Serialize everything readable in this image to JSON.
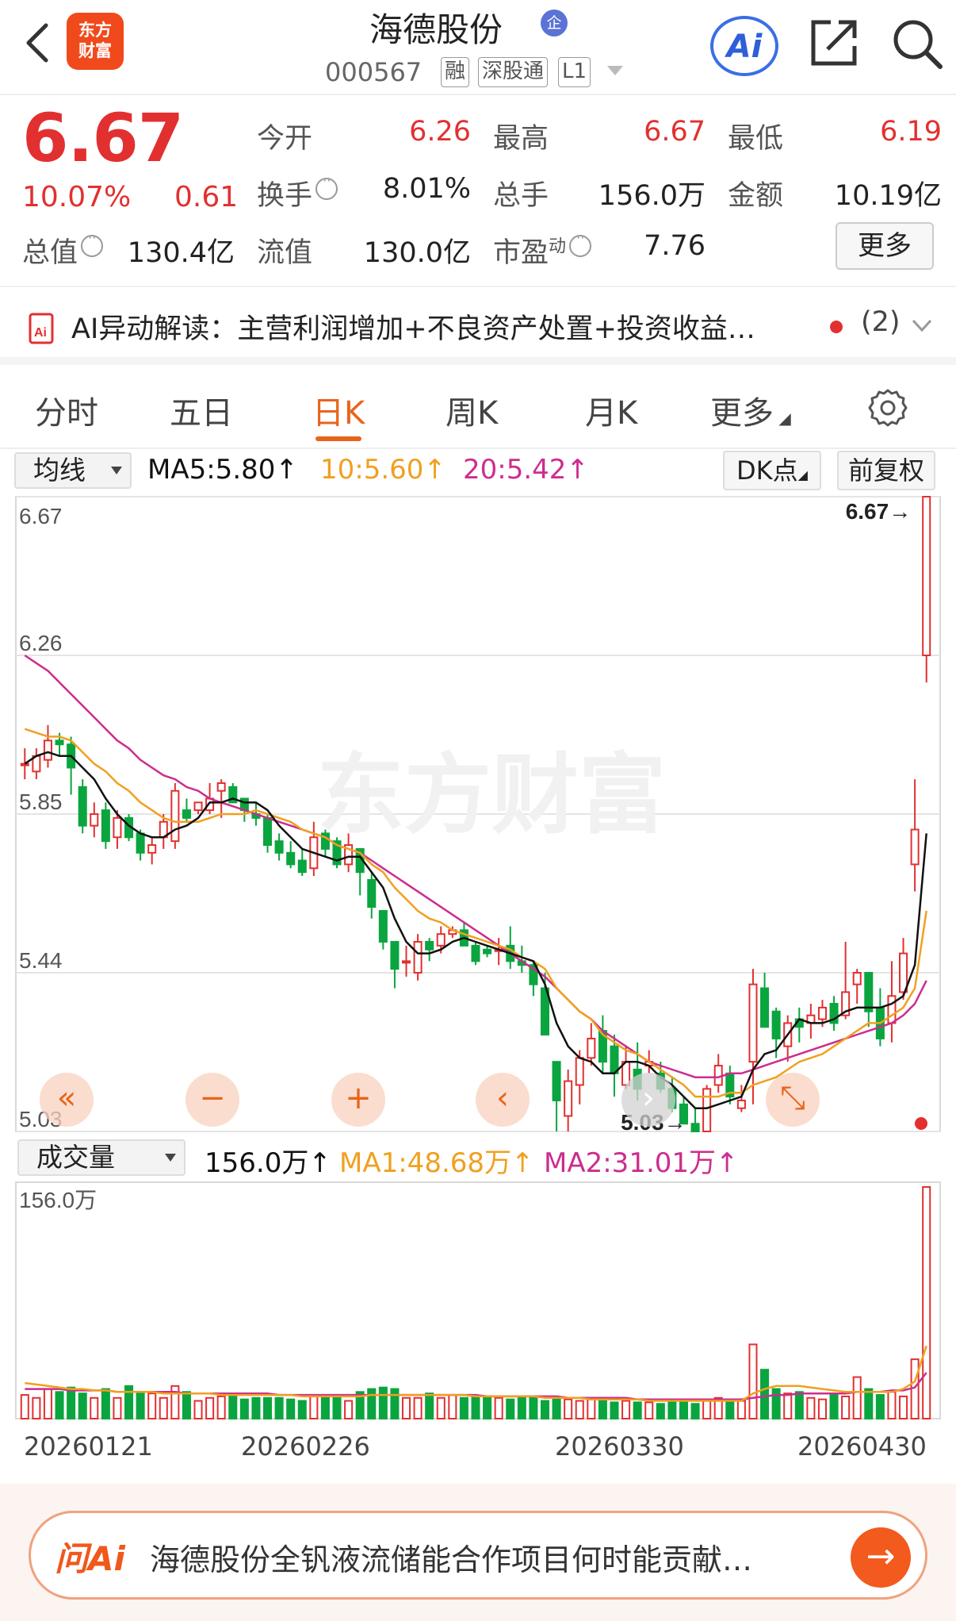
{
  "header": {
    "stock_name": "海德股份",
    "badge": "企",
    "code": "000567",
    "tags": [
      "融",
      "深股通",
      "L1"
    ],
    "logo_line1": "东方",
    "logo_line2": "财富",
    "ai_label": "Ai"
  },
  "quote": {
    "price": "6.67",
    "change_pct": "10.07%",
    "change_amt": "0.61",
    "fields": {
      "open_label": "今开",
      "open": "6.26",
      "high_label": "最高",
      "high": "6.67",
      "low_label": "最低",
      "low": "6.19",
      "turnover_label": "换手",
      "turnover": "8.01%",
      "volume_label": "总手",
      "volume": "156.0万",
      "amount_label": "金额",
      "amount": "10.19亿",
      "mktcap_label": "总值",
      "mktcap": "130.4亿",
      "float_label": "流值",
      "float": "130.0亿",
      "pe_label": "市盈",
      "pe_sup": "动",
      "pe": "7.76"
    },
    "more_label": "更多"
  },
  "ai_strip": {
    "text": "AI异动解读：主营利润增加+不良资产处置+投资收益…",
    "count": "(2)"
  },
  "tabs": [
    "分时",
    "五日",
    "日K",
    "周K",
    "月K",
    "更多"
  ],
  "active_tab": 2,
  "ma_bar": {
    "indicator": "均线",
    "ma5": "MA5:5.80",
    "ma10": "10:5.60",
    "ma20": "20:5.42",
    "dk_label": "DK点",
    "fuquan_label": "前复权"
  },
  "volume_bar": {
    "indicator": "成交量",
    "vol": "156.0万",
    "ma1": "MA1:48.68万",
    "ma2": "MA2:31.01万",
    "axis_top": "156.0万"
  },
  "controls": [
    "«",
    "−",
    "+",
    "‹",
    "›",
    "⤡"
  ],
  "chart_data": {
    "type": "candlestick",
    "y_ticks": [
      "6.67",
      "6.26",
      "5.85",
      "5.44",
      "5.03"
    ],
    "ylim": [
      5.03,
      6.67
    ],
    "max_label": "6.67",
    "min_label": "5.03",
    "x_labels": [
      "20260121",
      "20260226",
      "20260330",
      "20260430"
    ],
    "watermark": "东方财富",
    "colors": {
      "up": "#e23030",
      "down": "#0aa53f",
      "ma5": "#111111",
      "ma10": "#f0a020",
      "ma20": "#cc2d8e"
    },
    "candles": [
      [
        5.98,
        5.98,
        5.94,
        6.02
      ],
      [
        5.96,
        6.0,
        5.94,
        6.02
      ],
      [
        5.99,
        6.04,
        5.97,
        6.08
      ],
      [
        6.04,
        6.03,
        6.0,
        6.06
      ],
      [
        6.03,
        5.97,
        5.9,
        6.05
      ],
      [
        5.92,
        5.82,
        5.8,
        5.94
      ],
      [
        5.82,
        5.85,
        5.79,
        5.88
      ],
      [
        5.86,
        5.78,
        5.76,
        5.88
      ],
      [
        5.79,
        5.84,
        5.76,
        5.86
      ],
      [
        5.84,
        5.79,
        5.78,
        5.85
      ],
      [
        5.8,
        5.75,
        5.73,
        5.81
      ],
      [
        5.75,
        5.77,
        5.72,
        5.79
      ],
      [
        5.79,
        5.83,
        5.76,
        5.85
      ],
      [
        5.78,
        5.91,
        5.76,
        5.93
      ],
      [
        5.86,
        5.84,
        5.83,
        5.89
      ],
      [
        5.86,
        5.88,
        5.85,
        5.88
      ],
      [
        5.86,
        5.89,
        5.85,
        5.93
      ],
      [
        5.91,
        5.93,
        5.84,
        5.94
      ],
      [
        5.92,
        5.88,
        5.88,
        5.93
      ],
      [
        5.89,
        5.86,
        5.83,
        5.89
      ],
      [
        5.85,
        5.84,
        5.82,
        5.88
      ],
      [
        5.84,
        5.77,
        5.75,
        5.85
      ],
      [
        5.78,
        5.75,
        5.73,
        5.8
      ],
      [
        5.75,
        5.72,
        5.71,
        5.78
      ],
      [
        5.73,
        5.7,
        5.69,
        5.76
      ],
      [
        5.71,
        5.79,
        5.69,
        5.83
      ],
      [
        5.8,
        5.76,
        5.74,
        5.81
      ],
      [
        5.78,
        5.72,
        5.71,
        5.79
      ],
      [
        5.72,
        5.77,
        5.7,
        5.8
      ],
      [
        5.76,
        5.7,
        5.64,
        5.76
      ],
      [
        5.68,
        5.61,
        5.58,
        5.7
      ],
      [
        5.6,
        5.52,
        5.5,
        5.6
      ],
      [
        5.52,
        5.45,
        5.4,
        5.52
      ],
      [
        5.47,
        5.47,
        5.43,
        5.51
      ],
      [
        5.44,
        5.52,
        5.42,
        5.54
      ],
      [
        5.52,
        5.5,
        5.47,
        5.53
      ],
      [
        5.51,
        5.54,
        5.49,
        5.56
      ],
      [
        5.54,
        5.55,
        5.53,
        5.56
      ],
      [
        5.55,
        5.51,
        5.51,
        5.57
      ],
      [
        5.51,
        5.47,
        5.46,
        5.52
      ],
      [
        5.5,
        5.49,
        5.48,
        5.51
      ],
      [
        5.5,
        5.5,
        5.46,
        5.53
      ],
      [
        5.51,
        5.47,
        5.45,
        5.56
      ],
      [
        5.47,
        5.46,
        5.44,
        5.51
      ],
      [
        5.46,
        5.41,
        5.38,
        5.47
      ],
      [
        5.4,
        5.28,
        5.28,
        5.44
      ],
      [
        5.21,
        5.11,
        5.03,
        5.21
      ],
      [
        5.07,
        5.16,
        5.03,
        5.19
      ],
      [
        5.15,
        5.22,
        5.1,
        5.24
      ],
      [
        5.22,
        5.27,
        5.2,
        5.31
      ],
      [
        5.29,
        5.21,
        5.18,
        5.33
      ],
      [
        5.25,
        5.18,
        5.12,
        5.28
      ],
      [
        5.15,
        5.21,
        5.14,
        5.25
      ],
      [
        5.19,
        5.14,
        5.11,
        5.26
      ],
      [
        5.2,
        5.21,
        5.18,
        5.24
      ],
      [
        5.18,
        5.14,
        5.13,
        5.21
      ],
      [
        5.14,
        5.09,
        5.08,
        5.17
      ],
      [
        5.1,
        5.05,
        5.05,
        5.12
      ],
      [
        5.05,
        5.03,
        5.03,
        5.09
      ],
      [
        5.03,
        5.14,
        5.03,
        5.15
      ],
      [
        5.15,
        5.2,
        5.13,
        5.23
      ],
      [
        5.18,
        5.12,
        5.1,
        5.2
      ],
      [
        5.09,
        5.11,
        5.08,
        5.15
      ],
      [
        5.21,
        5.41,
        5.1,
        5.45
      ],
      [
        5.4,
        5.3,
        5.3,
        5.44
      ],
      [
        5.34,
        5.27,
        5.22,
        5.35
      ],
      [
        5.25,
        5.31,
        5.21,
        5.33
      ],
      [
        5.32,
        5.3,
        5.26,
        5.35
      ],
      [
        5.31,
        5.33,
        5.27,
        5.36
      ],
      [
        5.32,
        5.35,
        5.3,
        5.37
      ],
      [
        5.36,
        5.31,
        5.29,
        5.38
      ],
      [
        5.33,
        5.39,
        5.32,
        5.52
      ],
      [
        5.41,
        5.44,
        5.36,
        5.45
      ],
      [
        5.44,
        5.34,
        5.3,
        5.44
      ],
      [
        5.35,
        5.27,
        5.25,
        5.4
      ],
      [
        5.31,
        5.38,
        5.26,
        5.47
      ],
      [
        5.39,
        5.49,
        5.37,
        5.53
      ],
      [
        5.72,
        5.81,
        5.65,
        5.94
      ],
      [
        6.26,
        6.67,
        6.19,
        6.67
      ]
    ],
    "ma5": [
      5.98,
      6.0,
      6.01,
      6.0,
      6.0,
      5.97,
      5.94,
      5.89,
      5.85,
      5.82,
      5.8,
      5.79,
      5.79,
      5.81,
      5.82,
      5.84,
      5.88,
      5.88,
      5.89,
      5.88,
      5.88,
      5.86,
      5.82,
      5.79,
      5.76,
      5.75,
      5.74,
      5.73,
      5.74,
      5.74,
      5.7,
      5.66,
      5.58,
      5.52,
      5.49,
      5.49,
      5.5,
      5.52,
      5.53,
      5.52,
      5.51,
      5.5,
      5.49,
      5.48,
      5.47,
      5.41,
      5.31,
      5.25,
      5.22,
      5.21,
      5.18,
      5.18,
      5.21,
      5.21,
      5.2,
      5.17,
      5.15,
      5.12,
      5.09,
      5.09,
      5.1,
      5.11,
      5.12,
      5.19,
      5.23,
      5.24,
      5.28,
      5.32,
      5.31,
      5.31,
      5.32,
      5.34,
      5.35,
      5.35,
      5.35,
      5.36,
      5.38,
      5.46,
      5.8
    ],
    "ma10": [
      6.07,
      6.06,
      6.05,
      6.05,
      6.04,
      6.01,
      5.98,
      5.96,
      5.93,
      5.91,
      5.88,
      5.86,
      5.84,
      5.83,
      5.83,
      5.83,
      5.84,
      5.85,
      5.85,
      5.85,
      5.86,
      5.85,
      5.84,
      5.83,
      5.81,
      5.8,
      5.79,
      5.77,
      5.76,
      5.75,
      5.72,
      5.7,
      5.66,
      5.63,
      5.6,
      5.58,
      5.57,
      5.55,
      5.54,
      5.53,
      5.52,
      5.51,
      5.5,
      5.48,
      5.47,
      5.45,
      5.4,
      5.37,
      5.34,
      5.32,
      5.28,
      5.26,
      5.24,
      5.23,
      5.21,
      5.19,
      5.17,
      5.15,
      5.12,
      5.12,
      5.12,
      5.13,
      5.13,
      5.15,
      5.16,
      5.17,
      5.19,
      5.21,
      5.22,
      5.23,
      5.25,
      5.27,
      5.29,
      5.31,
      5.31,
      5.33,
      5.35,
      5.4,
      5.6
    ],
    "ma20": [
      6.26,
      6.24,
      6.22,
      6.19,
      6.16,
      6.13,
      6.1,
      6.07,
      6.04,
      6.02,
      5.99,
      5.97,
      5.95,
      5.94,
      5.92,
      5.91,
      5.89,
      5.88,
      5.87,
      5.86,
      5.85,
      5.84,
      5.83,
      5.82,
      5.81,
      5.8,
      5.79,
      5.77,
      5.76,
      5.75,
      5.73,
      5.71,
      5.69,
      5.67,
      5.65,
      5.63,
      5.61,
      5.59,
      5.57,
      5.55,
      5.53,
      5.51,
      5.49,
      5.47,
      5.45,
      5.43,
      5.4,
      5.37,
      5.34,
      5.32,
      5.29,
      5.27,
      5.25,
      5.23,
      5.21,
      5.2,
      5.19,
      5.18,
      5.17,
      5.17,
      5.17,
      5.18,
      5.18,
      5.19,
      5.2,
      5.21,
      5.22,
      5.23,
      5.24,
      5.25,
      5.26,
      5.27,
      5.28,
      5.29,
      5.3,
      5.31,
      5.33,
      5.36,
      5.42
    ],
    "volumes": [
      16,
      14,
      20,
      18,
      21,
      17,
      14,
      20,
      14,
      22,
      18,
      17,
      14,
      22,
      18,
      12,
      14,
      15,
      15,
      13,
      14,
      14,
      14,
      13,
      12,
      16,
      15,
      16,
      12,
      18,
      20,
      21,
      20,
      14,
      14,
      17,
      14,
      16,
      14,
      15,
      15,
      14,
      13,
      14,
      15,
      12,
      14,
      13,
      12,
      13,
      12,
      11,
      12,
      11,
      11,
      10,
      12,
      11,
      10,
      12,
      14,
      11,
      12,
      50,
      33,
      20,
      17,
      18,
      14,
      13,
      17,
      15,
      28,
      20,
      16,
      18,
      15,
      40,
      156
    ],
    "vol_ma1": [
      24,
      23,
      22,
      21,
      20,
      20,
      19,
      19,
      18,
      18,
      18,
      18,
      17,
      17,
      17,
      17,
      17,
      16,
      16,
      16,
      16,
      16,
      16,
      16,
      15,
      15,
      15,
      15,
      15,
      15,
      16,
      16,
      16,
      16,
      16,
      16,
      16,
      16,
      16,
      15,
      15,
      15,
      15,
      15,
      15,
      14,
      14,
      14,
      14,
      13,
      13,
      13,
      13,
      13,
      12,
      12,
      12,
      12,
      12,
      12,
      12,
      12,
      12,
      17,
      20,
      22,
      22,
      22,
      21,
      20,
      19,
      18,
      18,
      18,
      18,
      18,
      20,
      25,
      49
    ],
    "vol_ma2": [
      20,
      20,
      20,
      20,
      19,
      19,
      19,
      19,
      18,
      18,
      18,
      18,
      18,
      18,
      17,
      17,
      17,
      17,
      17,
      17,
      17,
      17,
      16,
      16,
      16,
      16,
      16,
      16,
      16,
      16,
      16,
      16,
      16,
      16,
      16,
      16,
      16,
      16,
      16,
      16,
      15,
      15,
      15,
      15,
      15,
      15,
      15,
      14,
      14,
      14,
      14,
      14,
      14,
      13,
      13,
      13,
      13,
      13,
      13,
      13,
      13,
      13,
      13,
      14,
      15,
      16,
      16,
      17,
      17,
      17,
      17,
      17,
      18,
      18,
      18,
      19,
      19,
      21,
      31
    ]
  },
  "ask_bar": {
    "logo": "问Ai",
    "text": "海德股份全钒液流储能合作项目何时能贡献…"
  }
}
